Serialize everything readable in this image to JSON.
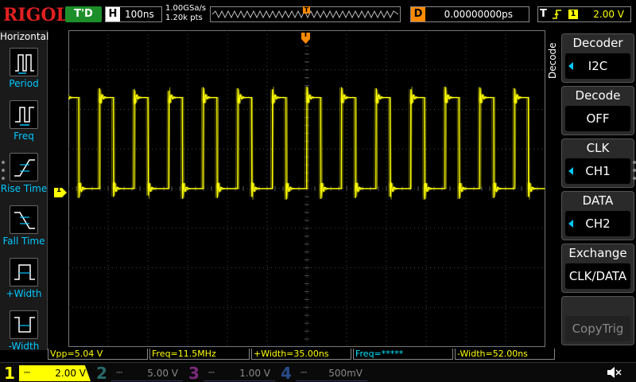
{
  "brand": "RIGOL",
  "top": {
    "trigger_status": "T'D",
    "horizontal_letter": "H",
    "timebase": "100ns",
    "sample_rate": "1.00GSa/s",
    "mem_depth": "1.20k pts",
    "mem_marker": "T",
    "delay_letter": "D",
    "delay_value": "0.00000000ps",
    "trig_letter": "T",
    "trig_edge_icon": "rising-edge-icon",
    "trig_source": "1",
    "trig_level": "2.00 V"
  },
  "left_panel": {
    "title": "Horizontal",
    "items": [
      {
        "label": "Period",
        "icon": "period-icon"
      },
      {
        "label": "Freq",
        "icon": "freq-icon"
      },
      {
        "label": "Rise Time",
        "icon": "rise-time-icon"
      },
      {
        "label": "Fall Time",
        "icon": "fall-time-icon"
      },
      {
        "label": "+Width",
        "icon": "pos-width-icon"
      },
      {
        "label": "-Width",
        "icon": "neg-width-icon"
      }
    ]
  },
  "screen": {
    "trigger_marker": "T",
    "ch1_marker": "1",
    "trig_level_marker": "T"
  },
  "right_panel": {
    "vertical_label": "Decode",
    "items": [
      {
        "head": "Decoder",
        "value": "I2C",
        "arrow": true
      },
      {
        "head": "Decode",
        "value": "OFF",
        "arrow": false
      },
      {
        "head": "CLK",
        "value": "CH1",
        "arrow": true
      },
      {
        "head": "DATA",
        "value": "CH2",
        "arrow": true
      },
      {
        "head": "Exchange",
        "value": "CLK/DATA",
        "arrow": false
      },
      {
        "head": "",
        "value": "CopyTrig",
        "arrow": false,
        "disabled": true
      }
    ]
  },
  "measurements": [
    {
      "text": "Vpp=5.04 V",
      "color": "#ffff00"
    },
    {
      "text": "Freq=11.5MHz",
      "color": "#ffff00"
    },
    {
      "text": "+Width=35.00ns",
      "color": "#ffff00"
    },
    {
      "text": "Freq=*****",
      "color": "#00e5ff"
    },
    {
      "text": "-Width=52.00ns",
      "color": "#ffff00"
    }
  ],
  "channels": [
    {
      "num": "1",
      "coupling": "⎓",
      "scale": "2.00 V",
      "color": "#ffff00",
      "active": true
    },
    {
      "num": "2",
      "coupling": "⎓",
      "scale": "5.00 V",
      "color": "#00e5ff",
      "active": false
    },
    {
      "num": "3",
      "coupling": "⎓",
      "scale": "1.00 V",
      "color": "#ff40ff",
      "active": false
    },
    {
      "num": "4",
      "coupling": "⎓",
      "scale": "500mV",
      "color": "#3a7bff",
      "active": false
    }
  ],
  "colors": {
    "ch1": "#ffff00",
    "ch2": "#00e5ff",
    "ch3": "#ff40ff",
    "ch4": "#3a7bff",
    "trigger": "#ff8a00",
    "accent": "#00c8ff"
  },
  "chart_data": {
    "type": "line",
    "title": "",
    "xlabel": "",
    "ylabel": "",
    "series": [
      {
        "name": "",
        "description": "square wave, ~11.5 MHz, low ≈ 0 V, high ≈ 4.5 V (2.00 V/div), with ringing on edges",
        "period_ns": 87,
        "pos_width_ns": 35,
        "neg_width_ns": 52,
        "low_v": 0.0,
        "high_v": 4.6
      }
    ],
    "x_range_ns": [
      -600,
      600
    ],
    "y_range_v": [
      -8,
      8
    ],
    "grid": true
  }
}
